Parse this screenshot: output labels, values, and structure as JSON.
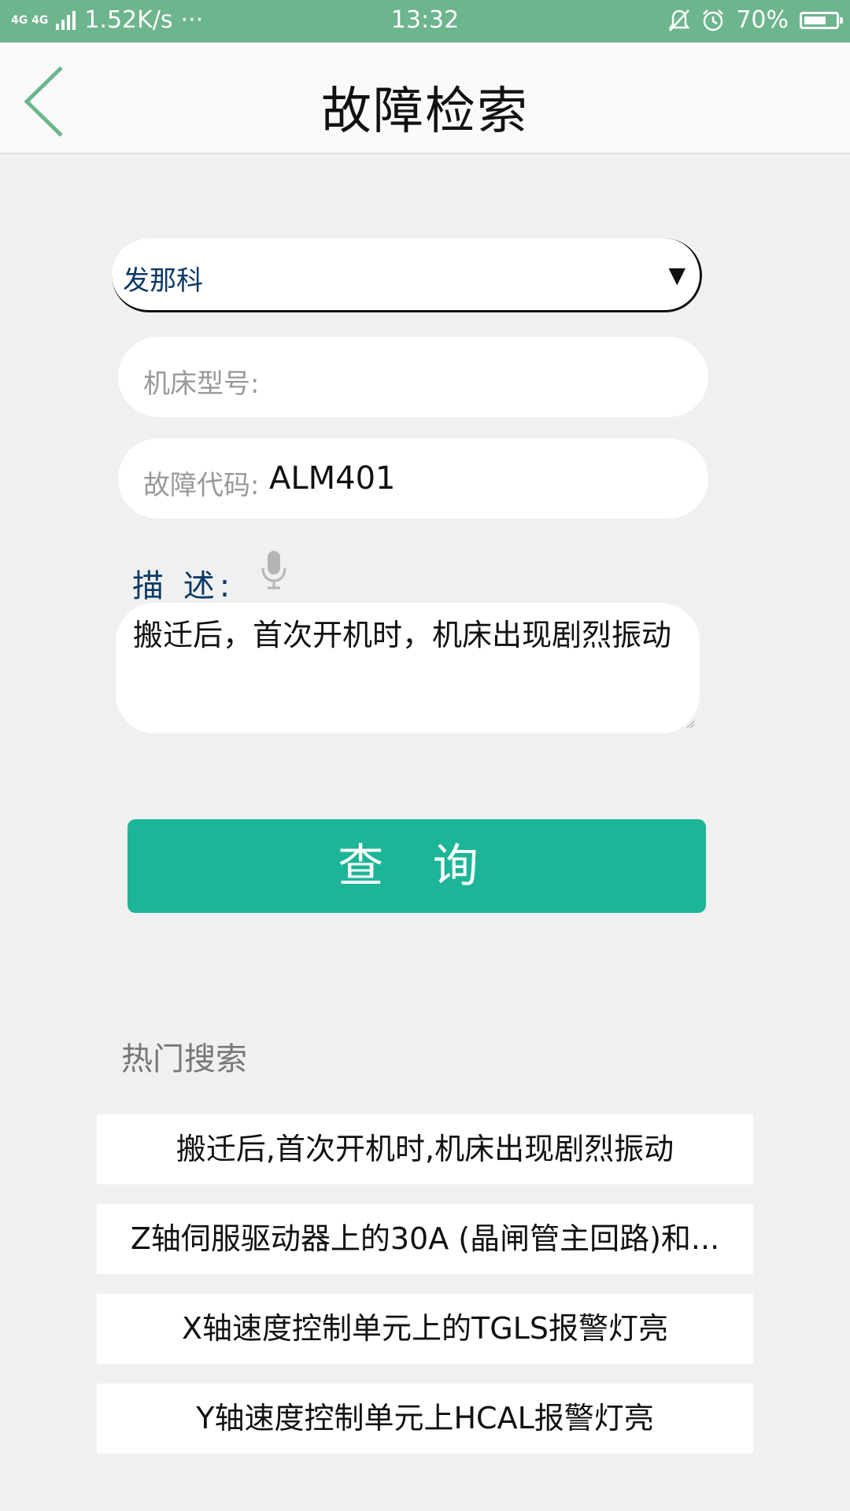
{
  "status_bar": {
    "network": "4G 4G",
    "speed": "1.52K/s",
    "more": "···",
    "time": "13:32",
    "battery": "70%",
    "battery_level": 0.7,
    "icons": [
      "signal-icon",
      "mute-icon",
      "alarm-icon",
      "battery-icon"
    ]
  },
  "header": {
    "title": "故障检索",
    "back_icon": "chevron-left-icon"
  },
  "form": {
    "brand_select": "发那科",
    "machine_model_label": "机床型号:",
    "machine_model_value": "",
    "fault_code_label": "故障代码:",
    "fault_code_value": "ALM401",
    "description_label": "描 述:",
    "mic_icon": "microphone-icon",
    "description_value": "搬迁后，首次开机时，机床出现剧烈振动"
  },
  "query_button": "查 询",
  "hot_search": {
    "title": "热门搜索",
    "items": [
      "搬迁后,首次开机时,机床出现剧烈振动",
      "Z轴伺服驱动器上的30A (晶闸管主回路)和...",
      "X轴速度控制单元上的TGLS报警灯亮",
      "Y轴速度控制单元上HCAL报警灯亮"
    ]
  },
  "colors": {
    "status_bar": "#6db58d",
    "accent": "#1cb597",
    "label_blue": "#0d3a66"
  }
}
